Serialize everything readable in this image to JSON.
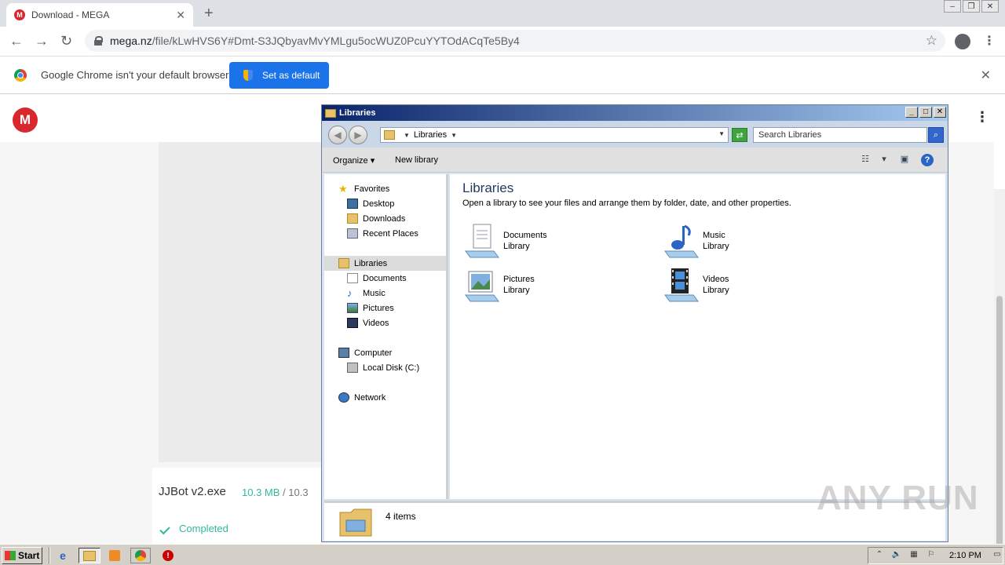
{
  "browser": {
    "tab_title": "Download - MEGA",
    "tab_favicon_letter": "M",
    "new_tab_symbol": "+",
    "url_host": "mega.nz",
    "url_path": "/file/kLwHVS6Y#Dmt-S3JQbyavMvYMLgu5ocWUZ0PcuYYTOdACqTe5By4",
    "infobar_text": "Google Chrome isn't your default browser",
    "set_default_label": "Set as default"
  },
  "mega": {
    "logo_letter": "M",
    "file_name": "JJBot v2.exe",
    "size_downloaded": "10.3 MB",
    "size_separator": " / ",
    "size_total": "10.3",
    "status": "Completed"
  },
  "explorer": {
    "title": "Libraries",
    "address": "Libraries",
    "search_placeholder": "Search Libraries",
    "cmd_organize": "Organize",
    "cmd_new_library": "New library",
    "heading": "Libraries",
    "description": "Open a library to see your files and arrange them by folder, date, and other properties.",
    "nav": {
      "favorites": "Favorites",
      "desktop": "Desktop",
      "downloads": "Downloads",
      "recent_places": "Recent Places",
      "libraries": "Libraries",
      "documents": "Documents",
      "music": "Music",
      "pictures": "Pictures",
      "videos": "Videos",
      "computer": "Computer",
      "local_disk": "Local Disk (C:)",
      "network": "Network"
    },
    "libraries": [
      {
        "name": "Documents",
        "type": "Library"
      },
      {
        "name": "Music",
        "type": "Library"
      },
      {
        "name": "Pictures",
        "type": "Library"
      },
      {
        "name": "Videos",
        "type": "Library"
      }
    ],
    "status_text": "4 items"
  },
  "taskbar": {
    "start_label": "Start",
    "clock": "2:10 PM"
  },
  "watermark": "ANY RUN",
  "colors": {
    "mega_red": "#d9272e",
    "chrome_blue": "#1a73e8",
    "mega_green": "#31b99e",
    "xp_title_blue": "#0a246a"
  }
}
